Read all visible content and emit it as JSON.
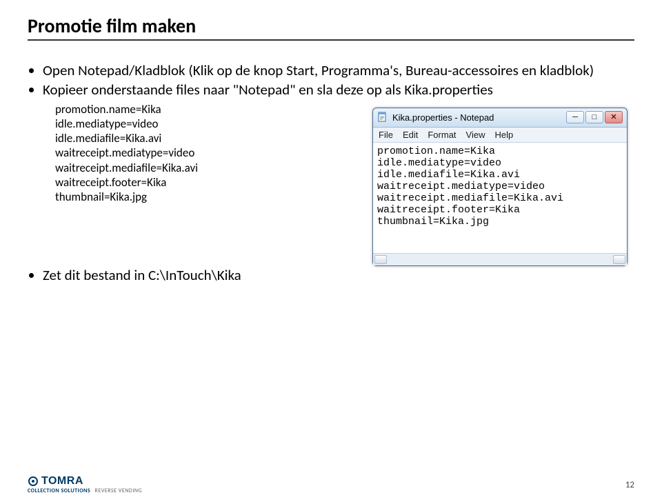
{
  "title": "Promotie film maken",
  "bullets": [
    "Open Notepad/Kladblok (Klik op de knop Start, Programma's, Bureau-accessoires en kladblok)",
    "Kopieer onderstaande files naar \"Notepad\" en sla deze op als Kika.properties"
  ],
  "code_lines": [
    "promotion.name=Kika",
    "idle.mediatype=video",
    "idle.mediafile=Kika.avi",
    "waitreceipt.mediatype=video",
    "waitreceipt.mediafile=Kika.avi",
    "waitreceipt.footer=Kika",
    "thumbnail=Kika.jpg"
  ],
  "bottom_bullet": "Zet dit bestand in C:\\InTouch\\Kika",
  "notepad": {
    "title": "Kika.properties - Notepad",
    "menu": [
      "File",
      "Edit",
      "Format",
      "View",
      "Help"
    ],
    "content": "promotion.name=Kika\nidle.mediatype=video\nidle.mediafile=Kika.avi\nwaitreceipt.mediatype=video\nwaitreceipt.mediafile=Kika.avi\nwaitreceipt.footer=Kika\nthumbnail=Kika.jpg"
  },
  "footer": {
    "brand": "TOMRA",
    "sub_cs": "COLLECTION SOLUTIONS",
    "sub_rv": "REVERSE VENDING",
    "page": "12"
  }
}
